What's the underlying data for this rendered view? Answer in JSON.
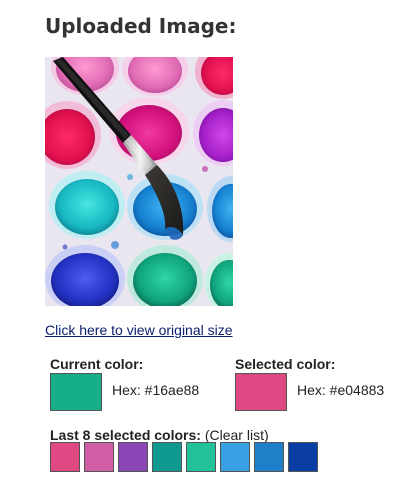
{
  "heading": "Uploaded Image:",
  "uploaded_image": {
    "description_icon": "watercolor-paint-palette-image"
  },
  "view_original_link": "Click here to view original size",
  "current_color": {
    "label": "Current color:",
    "hex_label": "Hex: #16ae88",
    "color": "#16ae88"
  },
  "selected_color": {
    "label": "Selected color:",
    "hex_label": "Hex: #e04883",
    "color": "#e04883"
  },
  "recent": {
    "label": "Last 8 selected colors:",
    "clear_label": "(Clear list)",
    "colors": [
      "#e04883",
      "#cf5ea6",
      "#8b47b5",
      "#10998e",
      "#22c19a",
      "#39a0e3",
      "#1f7fc9",
      "#0a3ea3"
    ]
  }
}
